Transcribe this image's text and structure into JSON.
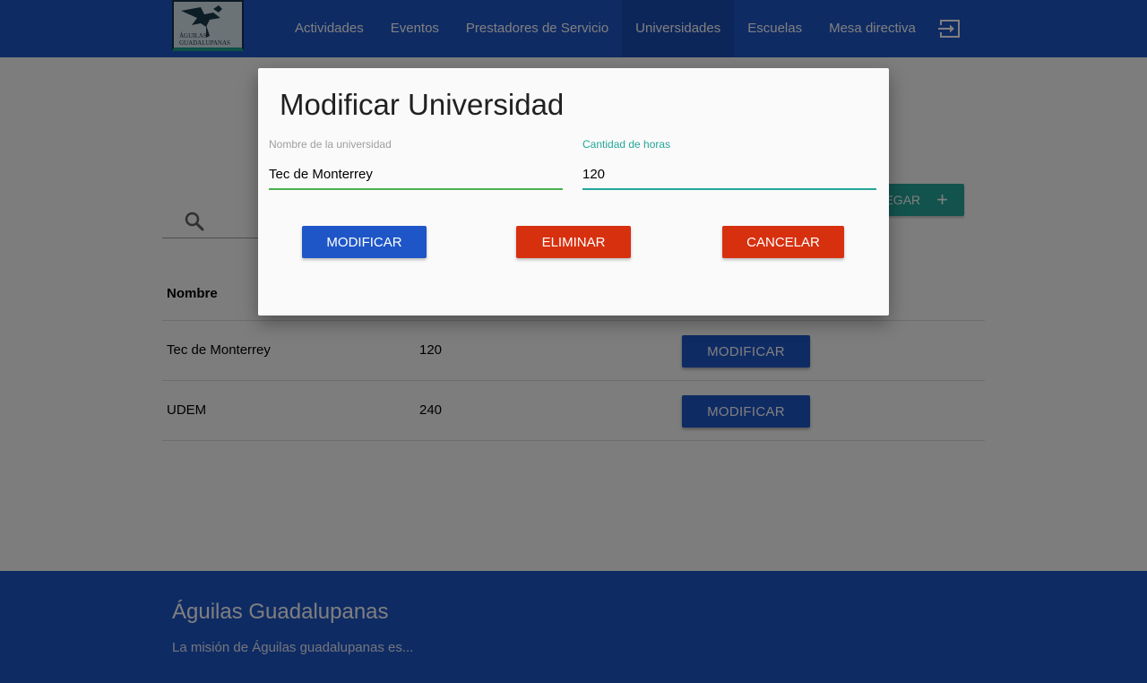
{
  "navbar": {
    "logo_text": "Águilas Guadalupanas",
    "items": [
      {
        "label": "Actividades"
      },
      {
        "label": "Eventos"
      },
      {
        "label": "Prestadores de Servicio"
      },
      {
        "label": "Universidades"
      },
      {
        "label": "Escuelas"
      },
      {
        "label": "Mesa directiva"
      }
    ],
    "active_item": "Universidades",
    "logout_icon": "exit-icon"
  },
  "main": {
    "add_button_label": "AGREGAR",
    "add_button_icon": "plus",
    "search_icon": "search-icon",
    "table": {
      "headers": [
        "Nombre"
      ],
      "rows": [
        {
          "name": "Tec de Monterrey",
          "hours": "120",
          "button": "MODIFICAR"
        },
        {
          "name": "UDEM",
          "hours": "240",
          "button": "MODIFICAR"
        }
      ]
    }
  },
  "footer": {
    "title": "Águilas Guadalupanas",
    "text": "La misión de Águilas guadalupanas es..."
  },
  "modal": {
    "title": "Modificar Universidad",
    "fields": {
      "name": {
        "label": "Nombre de la universidad",
        "value": "Tec de Monterrey"
      },
      "hours": {
        "label": "Cantidad de horas",
        "value": "120"
      }
    },
    "buttons": {
      "modify": "MODIFICAR",
      "delete": "ELIMINAR",
      "cancel": "CANCELAR"
    }
  },
  "colors": {
    "primary": "#1e56c8",
    "accent": "#26a69a",
    "danger": "#d7300f",
    "valid": "#4caf50"
  }
}
